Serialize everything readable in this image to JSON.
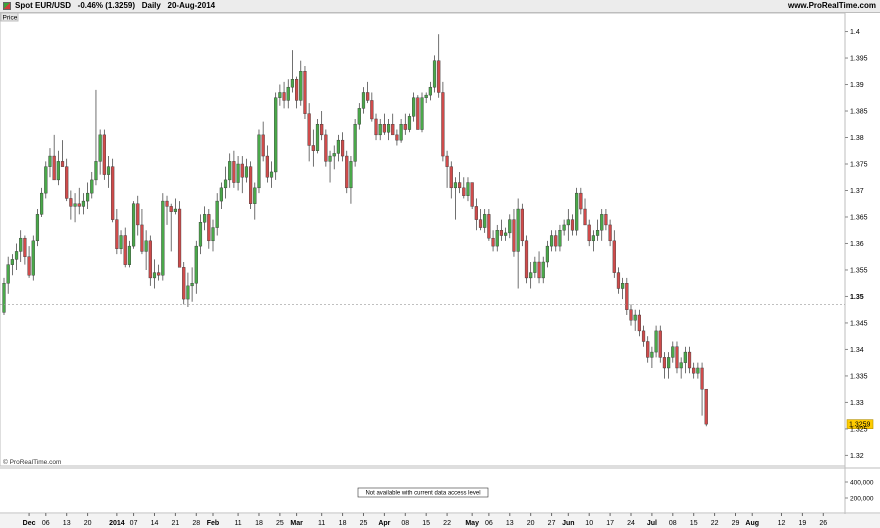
{
  "header": {
    "instrument": "Spot EUR/USD",
    "change": "-0.46% (1.3259)",
    "timeframe": "Daily",
    "date": "20-Aug-2014",
    "site": "www.ProRealTime.com"
  },
  "price_panel_label": "Price",
  "watermark": "© ProRealTime.com",
  "volume_panel": {
    "message": "Not available with current data access level",
    "ticks": [
      "400,000",
      "200,000"
    ]
  },
  "colors": {
    "up": "#4aa84a",
    "down": "#cf4b4b",
    "current_price_bg": "#ffcc00",
    "grid": "#dddddd"
  },
  "chart_data": {
    "type": "candlestick",
    "title": "Spot EUR/USD",
    "y_range": [
      1.318,
      1.4035
    ],
    "y_ticks": [
      1.4,
      1.395,
      1.39,
      1.385,
      1.38,
      1.375,
      1.37,
      1.365,
      1.36,
      1.355,
      1.35,
      1.345,
      1.34,
      1.335,
      1.33,
      1.325,
      1.32
    ],
    "y_tick_labels": [
      "1.4",
      "1.395",
      "1.39",
      "1.385",
      "1.38",
      "1.375",
      "1.37",
      "1.365",
      "1.36",
      "1.355",
      "1.35",
      "1.345",
      "1.34",
      "1.335",
      "1.33",
      "1.325",
      "1.32"
    ],
    "highlighted_y_labels": [
      "1.35"
    ],
    "reference_line": 1.3485,
    "current_price": 1.3259,
    "current_price_label": "1.3259",
    "x_labels": [
      {
        "label": "Dec",
        "bar": 6
      },
      {
        "label": "06",
        "bar": 10
      },
      {
        "label": "13",
        "bar": 15
      },
      {
        "label": "20",
        "bar": 20
      },
      {
        "label": "2014",
        "bar": 27
      },
      {
        "label": "07",
        "bar": 31
      },
      {
        "label": "14",
        "bar": 36
      },
      {
        "label": "21",
        "bar": 41
      },
      {
        "label": "28",
        "bar": 46
      },
      {
        "label": "Feb",
        "bar": 50
      },
      {
        "label": "11",
        "bar": 56
      },
      {
        "label": "18",
        "bar": 61
      },
      {
        "label": "25",
        "bar": 66
      },
      {
        "label": "Mar",
        "bar": 70
      },
      {
        "label": "11",
        "bar": 76
      },
      {
        "label": "18",
        "bar": 81
      },
      {
        "label": "25",
        "bar": 86
      },
      {
        "label": "Apr",
        "bar": 91
      },
      {
        "label": "08",
        "bar": 96
      },
      {
        "label": "15",
        "bar": 101
      },
      {
        "label": "22",
        "bar": 106
      },
      {
        "label": "May",
        "bar": 112
      },
      {
        "label": "06",
        "bar": 116
      },
      {
        "label": "13",
        "bar": 121
      },
      {
        "label": "20",
        "bar": 126
      },
      {
        "label": "27",
        "bar": 131
      },
      {
        "label": "Jun",
        "bar": 135
      },
      {
        "label": "10",
        "bar": 140
      },
      {
        "label": "17",
        "bar": 145
      },
      {
        "label": "24",
        "bar": 150
      },
      {
        "label": "Jul",
        "bar": 155
      },
      {
        "label": "08",
        "bar": 160
      },
      {
        "label": "15",
        "bar": 165
      },
      {
        "label": "22",
        "bar": 170
      },
      {
        "label": "29",
        "bar": 175
      },
      {
        "label": "Aug",
        "bar": 179
      },
      {
        "label": "12",
        "bar": 186
      },
      {
        "label": "19",
        "bar": 191
      },
      {
        "label": "26",
        "bar": 196
      }
    ],
    "candles": [
      [
        1.347,
        1.3535,
        1.3465,
        1.3525
      ],
      [
        1.3525,
        1.3575,
        1.3505,
        1.356
      ],
      [
        1.356,
        1.358,
        1.354,
        1.357
      ],
      [
        1.357,
        1.36,
        1.355,
        1.3585
      ],
      [
        1.3585,
        1.3625,
        1.3565,
        1.361
      ],
      [
        1.361,
        1.3615,
        1.356,
        1.3575
      ],
      [
        1.3575,
        1.3595,
        1.3535,
        1.354
      ],
      [
        1.354,
        1.3615,
        1.353,
        1.3605
      ],
      [
        1.3605,
        1.3665,
        1.3595,
        1.3655
      ],
      [
        1.3655,
        1.3705,
        1.365,
        1.3695
      ],
      [
        1.3695,
        1.3755,
        1.3685,
        1.3745
      ],
      [
        1.3745,
        1.378,
        1.3725,
        1.3765
      ],
      [
        1.3765,
        1.3805,
        1.375,
        1.372
      ],
      [
        1.372,
        1.3775,
        1.371,
        1.3755
      ],
      [
        1.3755,
        1.3795,
        1.3745,
        1.3745
      ],
      [
        1.3745,
        1.376,
        1.368,
        1.3685
      ],
      [
        1.3685,
        1.37,
        1.3645,
        1.367
      ],
      [
        1.367,
        1.3695,
        1.364,
        1.3675
      ],
      [
        1.3675,
        1.3705,
        1.3655,
        1.367
      ],
      [
        1.367,
        1.3695,
        1.3655,
        1.368
      ],
      [
        1.368,
        1.3715,
        1.3665,
        1.3695
      ],
      [
        1.3695,
        1.3735,
        1.3685,
        1.372
      ],
      [
        1.372,
        1.389,
        1.371,
        1.3755
      ],
      [
        1.3755,
        1.3815,
        1.373,
        1.3805
      ],
      [
        1.3805,
        1.3815,
        1.372,
        1.373
      ],
      [
        1.373,
        1.3765,
        1.3705,
        1.3745
      ],
      [
        1.3745,
        1.376,
        1.364,
        1.3645
      ],
      [
        1.3645,
        1.3665,
        1.358,
        1.359
      ],
      [
        1.359,
        1.3625,
        1.358,
        1.3615
      ],
      [
        1.3615,
        1.363,
        1.3555,
        1.356
      ],
      [
        1.356,
        1.3605,
        1.3555,
        1.3595
      ],
      [
        1.3595,
        1.368,
        1.359,
        1.3675
      ],
      [
        1.3675,
        1.369,
        1.3615,
        1.3635
      ],
      [
        1.3635,
        1.3665,
        1.358,
        1.3585
      ],
      [
        1.3585,
        1.3625,
        1.355,
        1.3605
      ],
      [
        1.3605,
        1.3615,
        1.352,
        1.3535
      ],
      [
        1.3535,
        1.357,
        1.3515,
        1.3545
      ],
      [
        1.3545,
        1.356,
        1.353,
        1.354
      ],
      [
        1.354,
        1.3695,
        1.353,
        1.368
      ],
      [
        1.368,
        1.369,
        1.3635,
        1.367
      ],
      [
        1.367,
        1.3675,
        1.3585,
        1.366
      ],
      [
        1.366,
        1.3685,
        1.3655,
        1.3665
      ],
      [
        1.3665,
        1.368,
        1.3585,
        1.3555
      ],
      [
        1.3555,
        1.3565,
        1.3485,
        1.3495
      ],
      [
        1.3495,
        1.3545,
        1.348,
        1.352
      ],
      [
        1.352,
        1.3555,
        1.349,
        1.3525
      ],
      [
        1.3525,
        1.3605,
        1.3505,
        1.3595
      ],
      [
        1.3595,
        1.3655,
        1.358,
        1.364
      ],
      [
        1.364,
        1.367,
        1.3625,
        1.3655
      ],
      [
        1.3655,
        1.3665,
        1.359,
        1.3605
      ],
      [
        1.3605,
        1.3645,
        1.3585,
        1.363
      ],
      [
        1.363,
        1.3695,
        1.3615,
        1.368
      ],
      [
        1.368,
        1.3715,
        1.3665,
        1.3705
      ],
      [
        1.3705,
        1.3745,
        1.3685,
        1.372
      ],
      [
        1.372,
        1.377,
        1.3705,
        1.3755
      ],
      [
        1.3755,
        1.3775,
        1.3705,
        1.3715
      ],
      [
        1.3715,
        1.3765,
        1.37,
        1.375
      ],
      [
        1.375,
        1.3765,
        1.3695,
        1.3725
      ],
      [
        1.3725,
        1.376,
        1.3715,
        1.3745
      ],
      [
        1.3745,
        1.3755,
        1.3665,
        1.3675
      ],
      [
        1.3675,
        1.3715,
        1.3645,
        1.3705
      ],
      [
        1.3705,
        1.3815,
        1.3695,
        1.3805
      ],
      [
        1.3805,
        1.383,
        1.3755,
        1.3765
      ],
      [
        1.3765,
        1.3785,
        1.3715,
        1.3725
      ],
      [
        1.3725,
        1.3755,
        1.3705,
        1.3735
      ],
      [
        1.3735,
        1.3885,
        1.372,
        1.3875
      ],
      [
        1.3875,
        1.39,
        1.386,
        1.3885
      ],
      [
        1.3885,
        1.3905,
        1.3855,
        1.387
      ],
      [
        1.387,
        1.391,
        1.3855,
        1.3895
      ],
      [
        1.3895,
        1.3965,
        1.3885,
        1.391
      ],
      [
        1.391,
        1.3915,
        1.3855,
        1.387
      ],
      [
        1.387,
        1.3945,
        1.386,
        1.3925
      ],
      [
        1.3925,
        1.3935,
        1.3835,
        1.3845
      ],
      [
        1.3845,
        1.3865,
        1.3755,
        1.3785
      ],
      [
        1.3785,
        1.3815,
        1.3745,
        1.3775
      ],
      [
        1.3775,
        1.3835,
        1.377,
        1.3825
      ],
      [
        1.3825,
        1.385,
        1.3795,
        1.3805
      ],
      [
        1.3805,
        1.3815,
        1.3745,
        1.3755
      ],
      [
        1.3755,
        1.3775,
        1.3715,
        1.3765
      ],
      [
        1.3765,
        1.3785,
        1.374,
        1.377
      ],
      [
        1.377,
        1.3805,
        1.3755,
        1.3795
      ],
      [
        1.3795,
        1.381,
        1.3755,
        1.3765
      ],
      [
        1.3765,
        1.3775,
        1.3695,
        1.3705
      ],
      [
        1.3705,
        1.3765,
        1.3675,
        1.3755
      ],
      [
        1.3755,
        1.3835,
        1.3745,
        1.3825
      ],
      [
        1.3825,
        1.3865,
        1.3815,
        1.3855
      ],
      [
        1.3855,
        1.3895,
        1.3845,
        1.3885
      ],
      [
        1.3885,
        1.3905,
        1.3865,
        1.387
      ],
      [
        1.387,
        1.3885,
        1.383,
        1.3835
      ],
      [
        1.3835,
        1.3845,
        1.3795,
        1.3805
      ],
      [
        1.3805,
        1.3835,
        1.3795,
        1.3825
      ],
      [
        1.3825,
        1.3845,
        1.3805,
        1.381
      ],
      [
        1.381,
        1.3835,
        1.3795,
        1.3825
      ],
      [
        1.3825,
        1.3845,
        1.3815,
        1.3805
      ],
      [
        1.3805,
        1.3815,
        1.3785,
        1.3795
      ],
      [
        1.3795,
        1.3835,
        1.379,
        1.3825
      ],
      [
        1.3825,
        1.3845,
        1.3805,
        1.3815
      ],
      [
        1.3815,
        1.3845,
        1.381,
        1.384
      ],
      [
        1.384,
        1.3885,
        1.383,
        1.3875
      ],
      [
        1.3875,
        1.388,
        1.3825,
        1.3815
      ],
      [
        1.3815,
        1.3885,
        1.381,
        1.3875
      ],
      [
        1.3875,
        1.3885,
        1.3865,
        1.388
      ],
      [
        1.388,
        1.3905,
        1.387,
        1.3895
      ],
      [
        1.3895,
        1.3955,
        1.3885,
        1.3945
      ],
      [
        1.3945,
        1.3995,
        1.3875,
        1.3885
      ],
      [
        1.3885,
        1.3905,
        1.3755,
        1.3765
      ],
      [
        1.3765,
        1.3775,
        1.3705,
        1.3745
      ],
      [
        1.3745,
        1.3755,
        1.3685,
        1.3705
      ],
      [
        1.3705,
        1.3725,
        1.3645,
        1.3715
      ],
      [
        1.3715,
        1.3735,
        1.3695,
        1.3705
      ],
      [
        1.3705,
        1.3725,
        1.3685,
        1.369
      ],
      [
        1.369,
        1.3725,
        1.368,
        1.3715
      ],
      [
        1.3715,
        1.3715,
        1.3665,
        1.367
      ],
      [
        1.367,
        1.3685,
        1.3625,
        1.3645
      ],
      [
        1.3645,
        1.3665,
        1.3625,
        1.363
      ],
      [
        1.363,
        1.3665,
        1.362,
        1.3655
      ],
      [
        1.3655,
        1.3665,
        1.3605,
        1.361
      ],
      [
        1.361,
        1.3625,
        1.3585,
        1.3595
      ],
      [
        1.3595,
        1.3635,
        1.3585,
        1.3625
      ],
      [
        1.3625,
        1.3645,
        1.3605,
        1.3615
      ],
      [
        1.3615,
        1.363,
        1.3605,
        1.362
      ],
      [
        1.362,
        1.3655,
        1.361,
        1.3645
      ],
      [
        1.3645,
        1.3665,
        1.3575,
        1.3585
      ],
      [
        1.3585,
        1.3685,
        1.3515,
        1.3665
      ],
      [
        1.3665,
        1.3675,
        1.3595,
        1.3605
      ],
      [
        1.3605,
        1.3615,
        1.3525,
        1.3535
      ],
      [
        1.3535,
        1.3565,
        1.3515,
        1.3545
      ],
      [
        1.3545,
        1.3575,
        1.3535,
        1.3565
      ],
      [
        1.3565,
        1.3585,
        1.3525,
        1.3535
      ],
      [
        1.3535,
        1.3575,
        1.3525,
        1.3565
      ],
      [
        1.3565,
        1.3605,
        1.3555,
        1.3595
      ],
      [
        1.3595,
        1.3625,
        1.3585,
        1.3615
      ],
      [
        1.3615,
        1.3625,
        1.3585,
        1.3595
      ],
      [
        1.3595,
        1.3635,
        1.3585,
        1.3625
      ],
      [
        1.3625,
        1.3645,
        1.3615,
        1.3635
      ],
      [
        1.3635,
        1.3665,
        1.3605,
        1.3645
      ],
      [
        1.3645,
        1.3655,
        1.3615,
        1.3625
      ],
      [
        1.3625,
        1.3705,
        1.3615,
        1.3695
      ],
      [
        1.3695,
        1.3705,
        1.3655,
        1.3665
      ],
      [
        1.3665,
        1.3685,
        1.3635,
        1.3635
      ],
      [
        1.3635,
        1.3645,
        1.3595,
        1.3605
      ],
      [
        1.3605,
        1.3625,
        1.3585,
        1.3615
      ],
      [
        1.3615,
        1.3645,
        1.3605,
        1.3625
      ],
      [
        1.3625,
        1.3665,
        1.3605,
        1.3655
      ],
      [
        1.3655,
        1.3665,
        1.3625,
        1.3635
      ],
      [
        1.3635,
        1.3645,
        1.3595,
        1.3605
      ],
      [
        1.3605,
        1.3625,
        1.3535,
        1.3545
      ],
      [
        1.3545,
        1.3555,
        1.3505,
        1.3515
      ],
      [
        1.3515,
        1.3535,
        1.3495,
        1.3525
      ],
      [
        1.3525,
        1.3535,
        1.3465,
        1.3475
      ],
      [
        1.3475,
        1.3485,
        1.3445,
        1.3455
      ],
      [
        1.3455,
        1.3475,
        1.3435,
        1.3465
      ],
      [
        1.3465,
        1.3475,
        1.3425,
        1.3435
      ],
      [
        1.3435,
        1.3445,
        1.3405,
        1.3415
      ],
      [
        1.3415,
        1.3425,
        1.3375,
        1.3385
      ],
      [
        1.3385,
        1.3405,
        1.3365,
        1.3395
      ],
      [
        1.3395,
        1.3445,
        1.3385,
        1.3435
      ],
      [
        1.3435,
        1.3445,
        1.3375,
        1.3385
      ],
      [
        1.3385,
        1.3395,
        1.3345,
        1.3365
      ],
      [
        1.3365,
        1.3395,
        1.3345,
        1.3385
      ],
      [
        1.3385,
        1.3415,
        1.3375,
        1.3405
      ],
      [
        1.3405,
        1.3415,
        1.3355,
        1.3365
      ],
      [
        1.3365,
        1.3385,
        1.3345,
        1.3375
      ],
      [
        1.3375,
        1.3405,
        1.3355,
        1.3395
      ],
      [
        1.3395,
        1.3405,
        1.3355,
        1.3365
      ],
      [
        1.3365,
        1.3375,
        1.3345,
        1.3355
      ],
      [
        1.3355,
        1.3375,
        1.3345,
        1.3365
      ],
      [
        1.3365,
        1.3375,
        1.3275,
        1.3325
      ],
      [
        1.3325,
        1.3325,
        1.3255,
        1.3259
      ]
    ]
  }
}
